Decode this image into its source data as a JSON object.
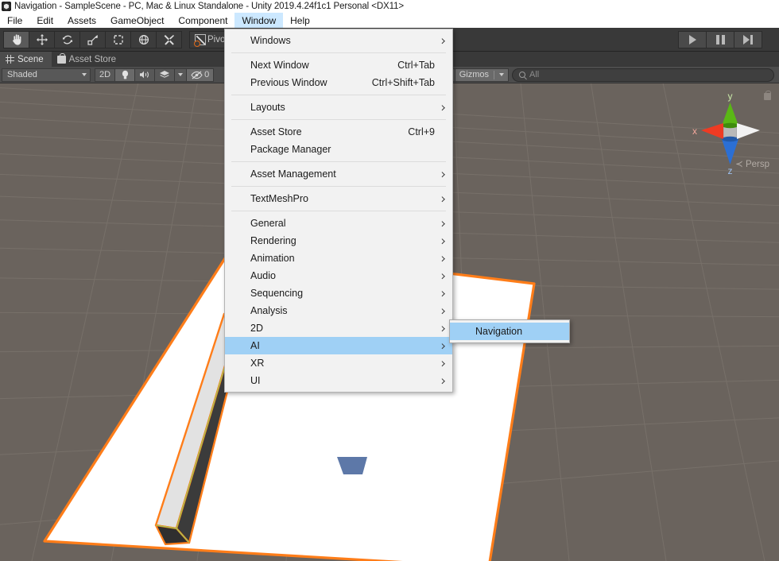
{
  "window": {
    "title": "Navigation - SampleScene - PC, Mac & Linux Standalone - Unity 2019.4.24f1c1 Personal <DX11>",
    "app_icon": "unity-logo-icon"
  },
  "menubar": {
    "items": [
      {
        "label": "File",
        "active": false
      },
      {
        "label": "Edit",
        "active": false
      },
      {
        "label": "Assets",
        "active": false
      },
      {
        "label": "GameObject",
        "active": false
      },
      {
        "label": "Component",
        "active": false
      },
      {
        "label": "Window",
        "active": true
      },
      {
        "label": "Help",
        "active": false
      }
    ]
  },
  "toolbar": {
    "tools": [
      {
        "name": "hand-tool-icon",
        "selected": true
      },
      {
        "name": "move-tool-icon",
        "selected": false
      },
      {
        "name": "rotate-tool-icon",
        "selected": false
      },
      {
        "name": "scale-tool-icon",
        "selected": false
      },
      {
        "name": "rect-tool-icon",
        "selected": false
      },
      {
        "name": "transform-tool-icon",
        "selected": false
      },
      {
        "name": "custom-tool-icon",
        "selected": false
      }
    ],
    "pivot_label": "Pivot",
    "play_label": "play-button",
    "pause_label": "pause-button",
    "step_label": "step-button",
    "overflow_label": "⋮"
  },
  "tabs": [
    {
      "label": "Scene",
      "icon": "scene-grid-icon",
      "active": true
    },
    {
      "label": "Asset Store",
      "icon": "asset-store-bag-icon",
      "active": false
    }
  ],
  "scenebar": {
    "draw_mode": "Shaded",
    "two_d_label": "2D",
    "lighting_icon": "lightbulb-icon",
    "audio_icon": "speaker-icon",
    "fx_icon": "effects-icon",
    "visibility_count": "0",
    "tools_icon": "scene-tools-icon",
    "camera_icon": "scene-camera-icon",
    "gizmos_label": "Gizmos",
    "search_placeholder": "All",
    "search_value": ""
  },
  "sceneview": {
    "gizmo": {
      "axis_x": "x",
      "axis_y": "y",
      "axis_z": "z",
      "x_color": "#ee3b23",
      "y_color": "#5ab715",
      "z_color": "#2b6fd4",
      "persp_label": "Persp",
      "lock_icon": "lock-icon"
    },
    "background_color": "#6a635d",
    "selection_color": "#ff7d19",
    "plane_color": "#ffffff"
  },
  "window_menu": {
    "groups": [
      [
        {
          "label": "Windows",
          "shortcut": "",
          "submenu": true,
          "highlight": false
        }
      ],
      [
        {
          "label": "Next Window",
          "shortcut": "Ctrl+Tab",
          "submenu": false,
          "highlight": false
        },
        {
          "label": "Previous Window",
          "shortcut": "Ctrl+Shift+Tab",
          "submenu": false,
          "highlight": false
        }
      ],
      [
        {
          "label": "Layouts",
          "shortcut": "",
          "submenu": true,
          "highlight": false
        }
      ],
      [
        {
          "label": "Asset Store",
          "shortcut": "Ctrl+9",
          "submenu": false,
          "highlight": false
        },
        {
          "label": "Package Manager",
          "shortcut": "",
          "submenu": false,
          "highlight": false
        }
      ],
      [
        {
          "label": "Asset Management",
          "shortcut": "",
          "submenu": true,
          "highlight": false
        }
      ],
      [
        {
          "label": "TextMeshPro",
          "shortcut": "",
          "submenu": true,
          "highlight": false
        }
      ],
      [
        {
          "label": "General",
          "shortcut": "",
          "submenu": true,
          "highlight": false
        },
        {
          "label": "Rendering",
          "shortcut": "",
          "submenu": true,
          "highlight": false
        },
        {
          "label": "Animation",
          "shortcut": "",
          "submenu": true,
          "highlight": false
        },
        {
          "label": "Audio",
          "shortcut": "",
          "submenu": true,
          "highlight": false
        },
        {
          "label": "Sequencing",
          "shortcut": "",
          "submenu": true,
          "highlight": false
        },
        {
          "label": "Analysis",
          "shortcut": "",
          "submenu": true,
          "highlight": false
        },
        {
          "label": "2D",
          "shortcut": "",
          "submenu": true,
          "highlight": false
        },
        {
          "label": "AI",
          "shortcut": "",
          "submenu": true,
          "highlight": true
        },
        {
          "label": "XR",
          "shortcut": "",
          "submenu": true,
          "highlight": false
        },
        {
          "label": "UI",
          "shortcut": "",
          "submenu": true,
          "highlight": false
        }
      ]
    ]
  },
  "ai_submenu": {
    "items": [
      {
        "label": "Navigation",
        "shortcut": "",
        "submenu": false,
        "highlight": true
      }
    ]
  }
}
